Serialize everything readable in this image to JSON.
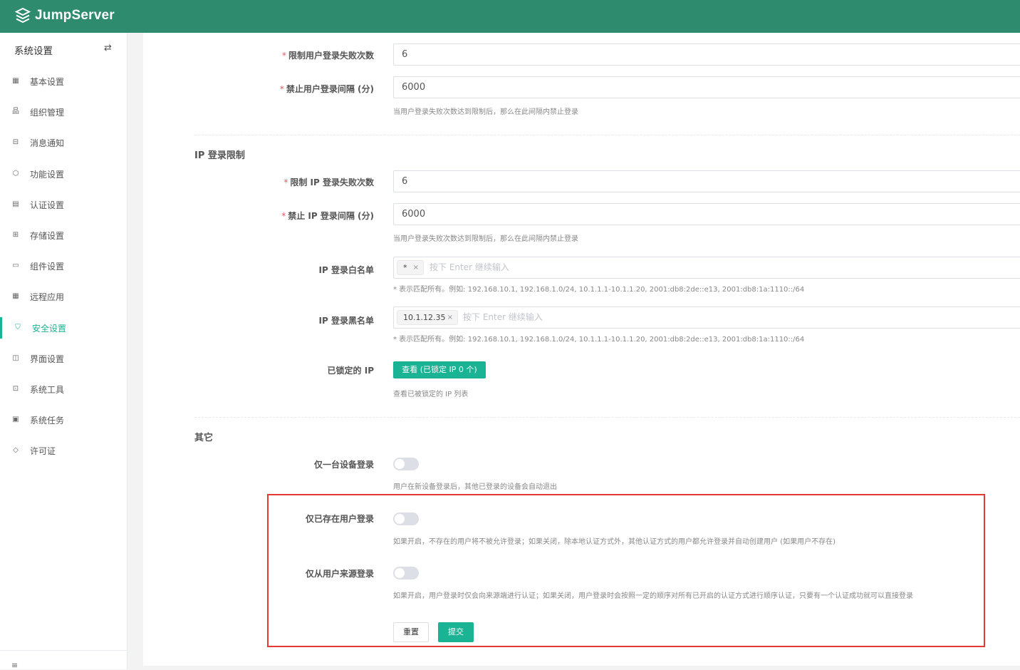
{
  "app": {
    "brand": "JumpServer"
  },
  "sidebar": {
    "title": "系统设置",
    "toggle_icon": "⇄",
    "items": [
      {
        "label": "基本设置",
        "icon": "grid-icon"
      },
      {
        "label": "组织管理",
        "icon": "org-icon"
      },
      {
        "label": "消息通知",
        "icon": "message-icon"
      },
      {
        "label": "功能设置",
        "icon": "cube-icon"
      },
      {
        "label": "认证设置",
        "icon": "id-card-icon"
      },
      {
        "label": "存储设置",
        "icon": "storage-icon"
      },
      {
        "label": "组件设置",
        "icon": "monitor-icon"
      },
      {
        "label": "远程应用",
        "icon": "apps-icon"
      },
      {
        "label": "安全设置",
        "icon": "shield-icon",
        "active": true
      },
      {
        "label": "界面设置",
        "icon": "layout-icon"
      },
      {
        "label": "系统工具",
        "icon": "toolbox-icon"
      },
      {
        "label": "系统任务",
        "icon": "task-icon"
      },
      {
        "label": "许可证",
        "icon": "diamond-icon"
      }
    ],
    "collapse_icon": "≡"
  },
  "user_login": {
    "fail_limit_label": "限制用户登录失败次数",
    "fail_limit_value": "6",
    "block_interval_label": "禁止用户登录间隔 (分)",
    "block_interval_value": "6000",
    "block_help": "当用户登录失败次数达到限制后，那么在此间隔内禁止登录"
  },
  "ip_login": {
    "section_title": "IP 登录限制",
    "fail_limit_label": "限制 IP 登录失败次数",
    "fail_limit_value": "6",
    "block_interval_label": "禁止 IP 登录间隔 (分)",
    "block_interval_value": "6000",
    "block_help": "当用户登录失败次数达到限制后，那么在此间隔内禁止登录",
    "whitelist_label": "IP 登录白名单",
    "whitelist_tags": [
      "*"
    ],
    "whitelist_placeholder": "按下 Enter 继续输入",
    "whitelist_help": "* 表示匹配所有。例如: 192.168.10.1, 192.168.1.0/24, 10.1.1.1-10.1.1.20, 2001:db8:2de::e13, 2001:db8:1a:1110::/64",
    "blacklist_label": "IP 登录黑名单",
    "blacklist_tags": [
      "10.1.12.35"
    ],
    "blacklist_placeholder": "按下 Enter 继续输入",
    "blacklist_help": "* 表示匹配所有。例如: 192.168.10.1, 192.168.1.0/24, 10.1.1.1-10.1.1.20, 2001:db8:2de::e13, 2001:db8:1a:1110::/64",
    "locked_label": "已锁定的 IP",
    "locked_button": "查看 (已锁定 IP 0 个)",
    "locked_help": "查看已被锁定的 IP 列表"
  },
  "other": {
    "section_title": "其它",
    "single_device_label": "仅一台设备登录",
    "single_device_on": false,
    "single_device_help": "用户在新设备登录后，其他已登录的设备会自动退出",
    "existing_user_label": "仅已存在用户登录",
    "existing_user_on": false,
    "existing_user_help": "如果开启，不存在的用户将不被允许登录；如果关闭，除本地认证方式外，其他认证方式的用户都允许登录并自动创建用户 (如果用户不存在)",
    "source_login_label": "仅从用户来源登录",
    "source_login_on": false,
    "source_login_help": "如果开启，用户登录时仅会向来源端进行认证；如果关闭，用户登录时会按照一定的顺序对所有已开启的认证方式进行顺序认证，只要有一个认证成功就可以直接登录"
  },
  "actions": {
    "reset": "重置",
    "submit": "提交"
  },
  "colors": {
    "brand": "#2e8b6e",
    "accent": "#1ab394",
    "highlight": "#e53935"
  }
}
